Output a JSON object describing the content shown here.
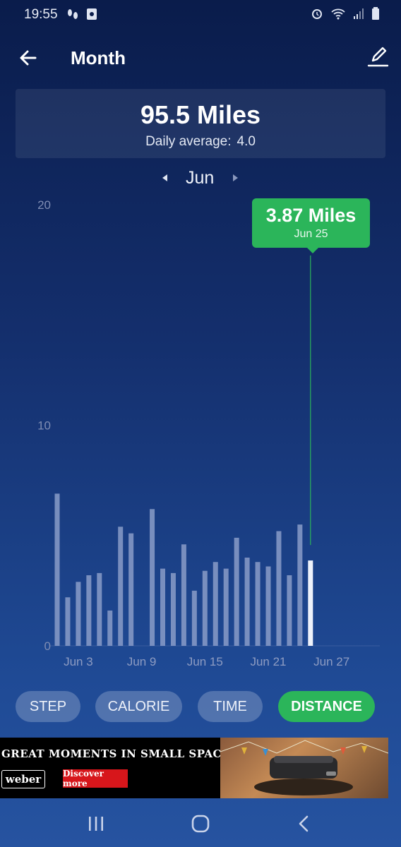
{
  "status": {
    "time": "19:55"
  },
  "header": {
    "title": "Month"
  },
  "summary": {
    "total": "95.5 Miles",
    "avg_label": "Daily average:",
    "avg_value": "4.0"
  },
  "month_nav": {
    "label": "Jun"
  },
  "chart_data": {
    "type": "bar",
    "categories": [
      "Jun 1",
      "Jun 2",
      "Jun 3",
      "Jun 4",
      "Jun 5",
      "Jun 6",
      "Jun 7",
      "Jun 8",
      "Jun 9",
      "Jun 10",
      "Jun 11",
      "Jun 12",
      "Jun 13",
      "Jun 14",
      "Jun 15",
      "Jun 16",
      "Jun 17",
      "Jun 18",
      "Jun 19",
      "Jun 20",
      "Jun 21",
      "Jun 22",
      "Jun 23",
      "Jun 24",
      "Jun 25"
    ],
    "values": [
      6.9,
      2.2,
      2.9,
      3.2,
      3.3,
      1.6,
      5.4,
      5.1,
      0,
      6.2,
      3.5,
      3.3,
      4.6,
      2.5,
      3.4,
      3.8,
      3.5,
      4.9,
      4.0,
      3.8,
      3.6,
      5.2,
      3.2,
      5.5,
      3.87
    ],
    "selected_index": 24,
    "xticks": [
      "Jun 3",
      "Jun 9",
      "Jun 15",
      "Jun 21",
      "Jun 27"
    ],
    "yticks": [
      "0",
      "10",
      "20"
    ],
    "ylim": [
      0,
      20
    ],
    "grid": false,
    "colors": {
      "bar": "#8a9cc8",
      "selected": "#eef2fb",
      "line": "#2bb55a"
    }
  },
  "tooltip": {
    "value": "3.87 Miles",
    "date": "Jun 25"
  },
  "tabs": [
    {
      "label": "STEP",
      "active": false
    },
    {
      "label": "CALORIE",
      "active": false
    },
    {
      "label": "TIME",
      "active": false
    },
    {
      "label": "DISTANCE",
      "active": true
    }
  ],
  "ad": {
    "headline": "GREAT MOMENTS IN SMALL SPACES",
    "brand": "weber",
    "cta": "Discover more"
  },
  "colors": {
    "accent": "#2bb55a"
  }
}
